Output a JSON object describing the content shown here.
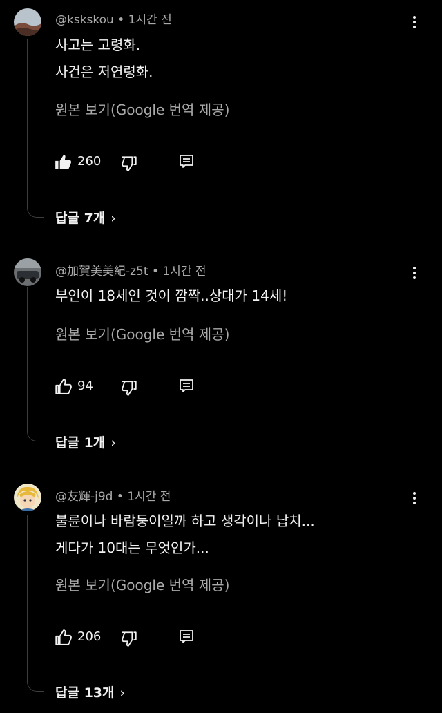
{
  "comments": [
    {
      "handle": "@kskskou",
      "time": "1시간 전",
      "lines": [
        "사고는 고령화.",
        "사건은 저연령화."
      ],
      "translate_label": "원본 보기(Google 번역 제공)",
      "likes": "260",
      "liked": true,
      "replies_label": "답글 7개"
    },
    {
      "handle": "@加賀美美紀-z5t",
      "time": "1시간 전",
      "lines": [
        "부인이 18세인 것이 깜짝..상대가 14세!"
      ],
      "translate_label": "원본 보기(Google 번역 제공)",
      "likes": "94",
      "liked": false,
      "replies_label": "답글 1개"
    },
    {
      "handle": "@友輝-j9d",
      "time": "1시간 전",
      "lines": [
        "불륜이나 바람둥이일까 하고 생각이나 납치...",
        "게다가 10대는 무엇인가..."
      ],
      "translate_label": "원본 보기(Google 번역 제공)",
      "likes": "206",
      "liked": false,
      "replies_label": "답글 13개"
    }
  ],
  "separator": "•",
  "icons": {
    "like": "thumb-up-icon",
    "dislike": "thumb-down-icon",
    "reply": "reply-comment-icon",
    "menu": "more-vert-icon",
    "chevron": "chevron-right-icon"
  },
  "colors": {
    "background": "#000000",
    "primary_text": "#f1f1f1",
    "secondary_text": "#aaaaaa",
    "thread_line": "#3d3d3d"
  }
}
